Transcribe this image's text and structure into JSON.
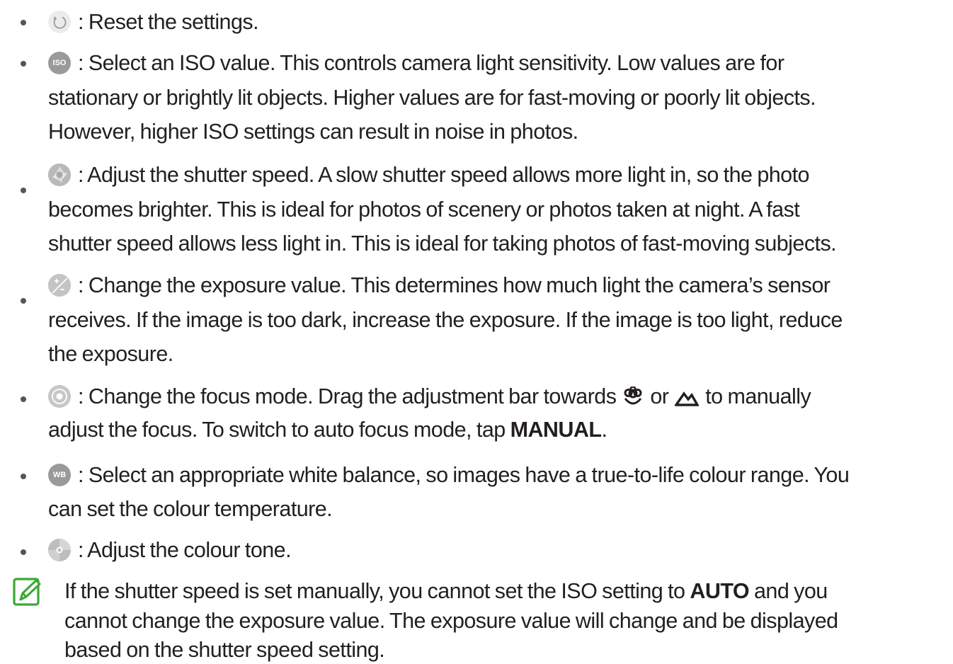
{
  "items": [
    {
      "icon": "reset-icon",
      "lines": [
        ": Reset the settings."
      ]
    },
    {
      "icon": "iso-icon",
      "icon_label": "ISO",
      "lines": [
        ": Select an ISO value. This controls camera light sensitivity. Low values are for",
        "stationary or brightly lit objects. Higher values are for fast-moving or poorly lit objects.",
        "However, higher ISO settings can result in noise in photos."
      ]
    },
    {
      "icon": "shutter-speed-icon",
      "lines": [
        ": Adjust the shutter speed. A slow shutter speed allows more light in, so the photo",
        "becomes brighter. This is ideal for photos of scenery or photos taken at night. A fast",
        "shutter speed allows less light in. This is ideal for taking photos of fast-moving subjects."
      ]
    },
    {
      "icon": "exposure-value-icon",
      "lines": [
        ": Change the exposure value. This determines how much light the camera’s sensor",
        "receives. If the image is too dark, increase the exposure. If the image is too light, reduce",
        "the exposure."
      ]
    },
    {
      "icon": "focus-mode-icon",
      "line1_part1": ": Change the focus mode. Drag the adjustment bar towards",
      "line1_part2": "or",
      "line1_part3": "to manually",
      "line2_part1": "adjust the focus. To switch to auto focus mode, tap",
      "line2_bold": "MANUAL",
      "line2_end": "."
    },
    {
      "icon": "white-balance-icon",
      "icon_label": "WB",
      "lines": [
        ": Select an appropriate white balance, so images have a true-to-life colour range. You",
        "can set the colour temperature."
      ]
    },
    {
      "icon": "colour-tone-icon",
      "lines": [
        ": Adjust the colour tone."
      ]
    }
  ],
  "note": {
    "icon": "note-icon",
    "accent_color": "#3aa935",
    "line1_part1": "If the shutter speed is set manually, you cannot set the ISO setting to",
    "line1_bold": "AUTO",
    "line1_part2": "and you",
    "line2": "cannot change the exposure value. The exposure value will change and be displayed",
    "line3": "based on the shutter speed setting."
  }
}
